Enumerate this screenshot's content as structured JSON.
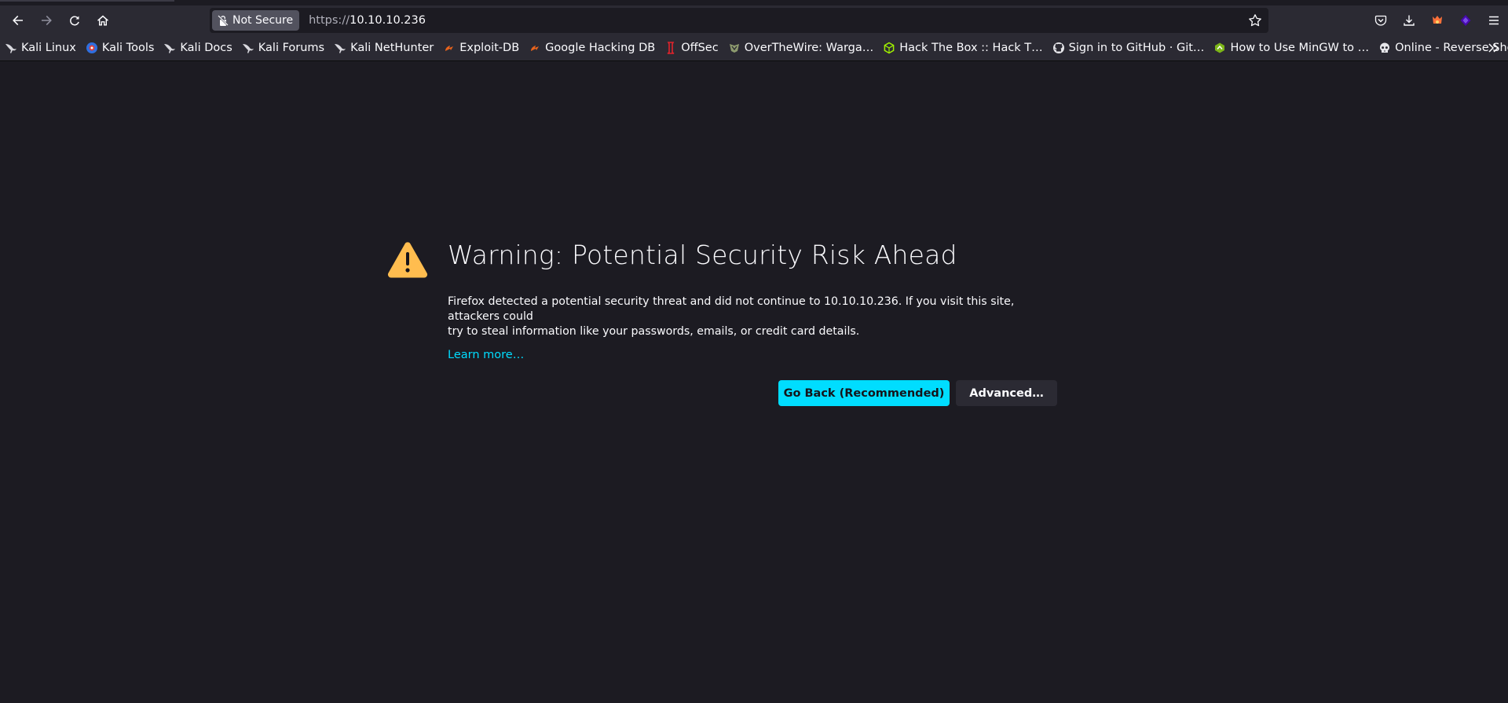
{
  "browser": {
    "url_scheme": "https://",
    "url_host": "10.10.10.236",
    "security_label": "Not Secure"
  },
  "bookmarks": [
    {
      "label": "Kali Linux",
      "icon": "kali-dragon-icon"
    },
    {
      "label": "Kali Tools",
      "icon": "kali-tools-icon"
    },
    {
      "label": "Kali Docs",
      "icon": "kali-dragon-icon"
    },
    {
      "label": "Kali Forums",
      "icon": "kali-dragon-icon"
    },
    {
      "label": "Kali NetHunter",
      "icon": "kali-dragon-icon"
    },
    {
      "label": "Exploit-DB",
      "icon": "exploit-db-icon"
    },
    {
      "label": "Google Hacking DB",
      "icon": "exploit-db-icon"
    },
    {
      "label": "OffSec",
      "icon": "offsec-icon"
    },
    {
      "label": "OverTheWire: Warga…",
      "icon": "overthewire-icon"
    },
    {
      "label": "Hack The Box :: Hack T…",
      "icon": "hackthebox-icon"
    },
    {
      "label": "Sign in to GitHub · Git…",
      "icon": "github-icon"
    },
    {
      "label": "How to Use MinGW to …",
      "icon": "mingw-icon"
    },
    {
      "label": "Online - Reverse Shell …",
      "icon": "skull-icon"
    }
  ],
  "error_page": {
    "title": "Warning: Potential Security Risk Ahead",
    "description_line1": "Firefox detected a potential security threat and did not continue to 10.10.10.236. If you visit this site, attackers could",
    "description_line2": "try to steal information like your passwords, emails, or credit card details.",
    "learn_more": "Learn more…",
    "go_back_label": "Go Back (Recommended)",
    "advanced_label": "Advanced…"
  },
  "colors": {
    "page_bg": "#1c1b22",
    "toolbar_bg": "#2b2a33",
    "accent": "#00ddff",
    "warning": "#ffbd4f"
  }
}
